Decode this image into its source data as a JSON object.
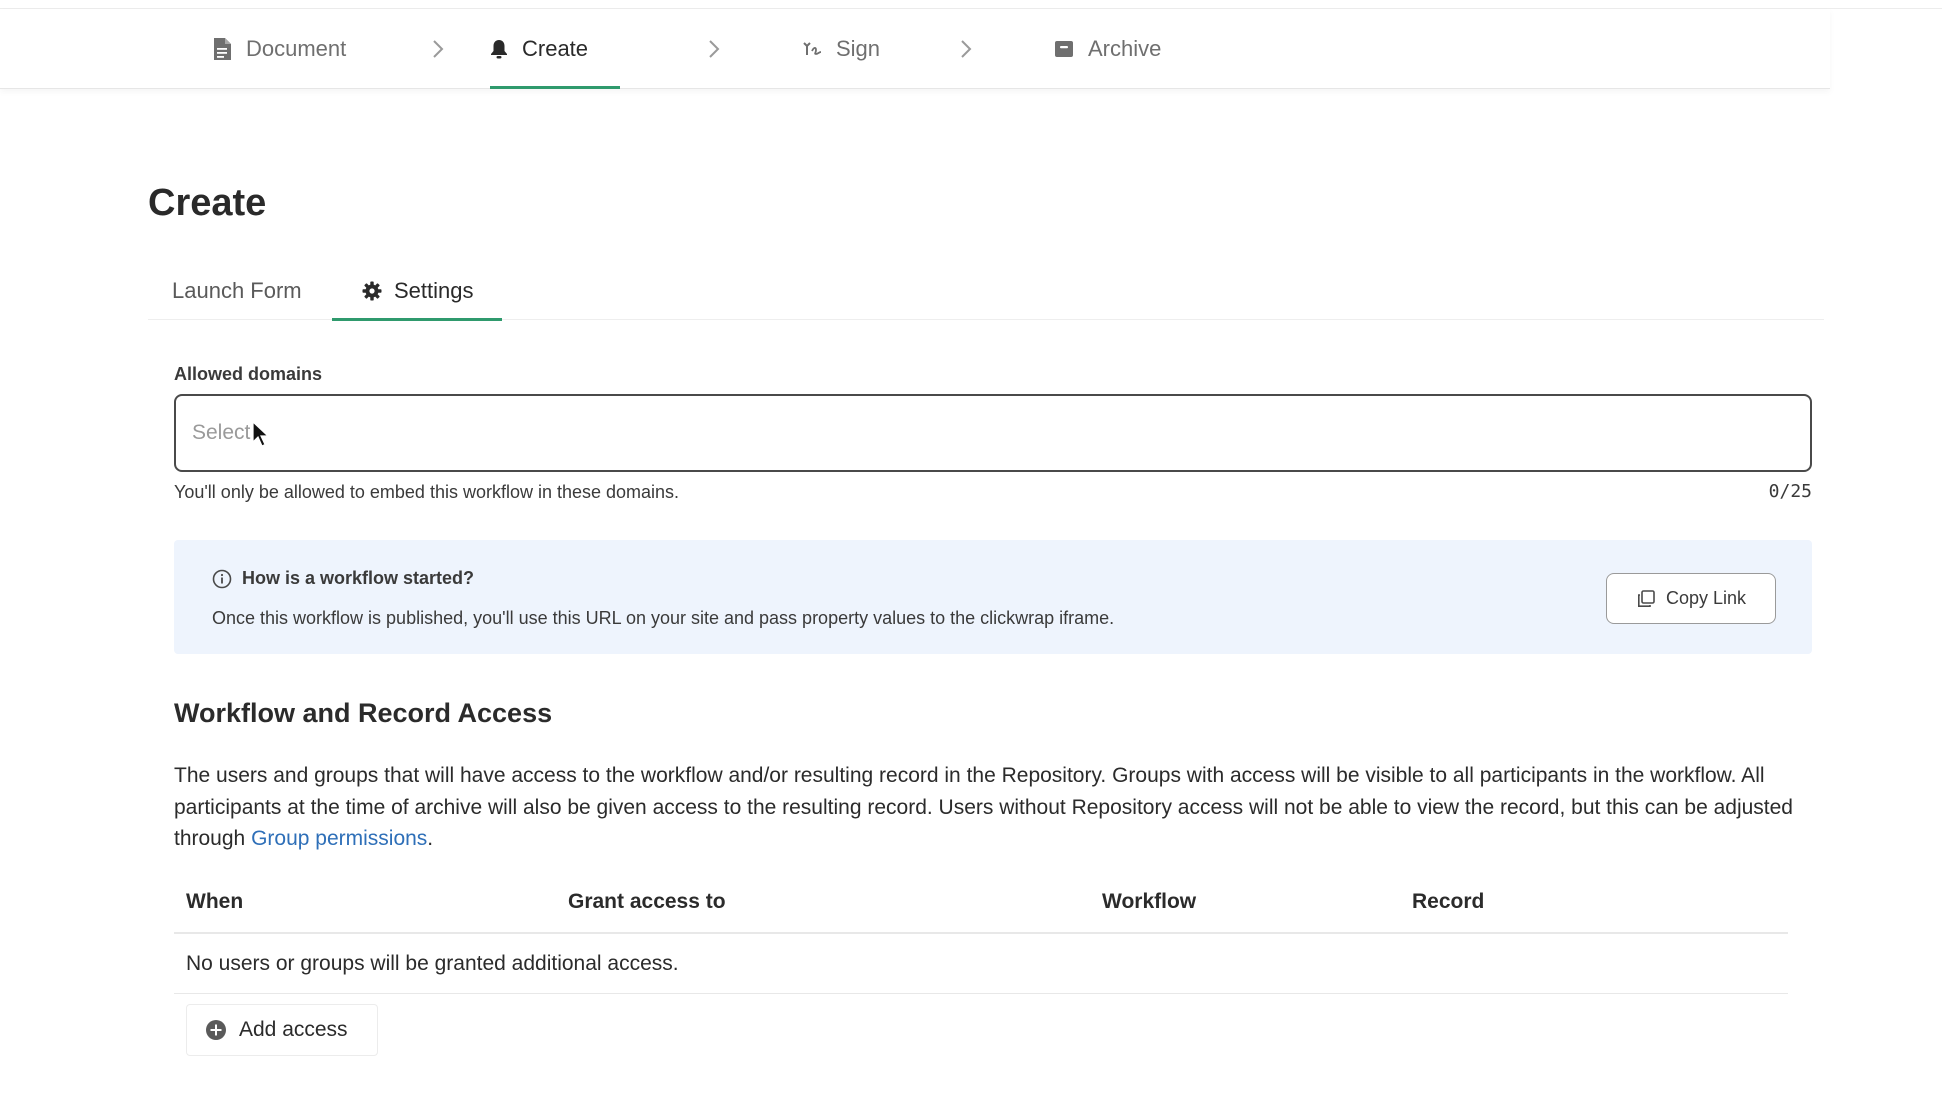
{
  "stepper": {
    "steps": [
      {
        "label": "Document",
        "icon": "document-icon"
      },
      {
        "label": "Create",
        "icon": "bell-icon"
      },
      {
        "label": "Sign",
        "icon": "signature-icon"
      },
      {
        "label": "Archive",
        "icon": "archive-box-icon"
      }
    ],
    "active": "Create",
    "accent_color": "#2f9a6d"
  },
  "page": {
    "title": "Create"
  },
  "tabs": {
    "items": [
      {
        "label": "Launch Form"
      },
      {
        "label": "Settings",
        "icon": "gear-icon"
      }
    ],
    "active": "Settings"
  },
  "allowed_domains": {
    "label": "Allowed domains",
    "placeholder": "Select",
    "helper": "You'll only be allowed to embed this workflow in these domains.",
    "counter": "0/25"
  },
  "info": {
    "title": "How is a workflow started?",
    "text": "Once this workflow is published, you'll use this URL on your site and pass property values to the clickwrap iframe.",
    "copy_label": "Copy Link"
  },
  "access": {
    "title": "Workflow and Record Access",
    "description": "The users and groups that will have access to the workflow and/or resulting record in the Repository. Groups with access will be visible to all participants in the workflow. All participants at the time of archive will also be given access to the resulting record. Users without Repository access will not be able to view the record, but this can be adjusted through ",
    "link_text": "Group permissions",
    "link_color": "#2e6fb8",
    "columns": [
      "When",
      "Grant access to",
      "Workflow",
      "Record"
    ],
    "empty_text": "No users or groups will be granted additional access.",
    "add_label": "Add access"
  }
}
